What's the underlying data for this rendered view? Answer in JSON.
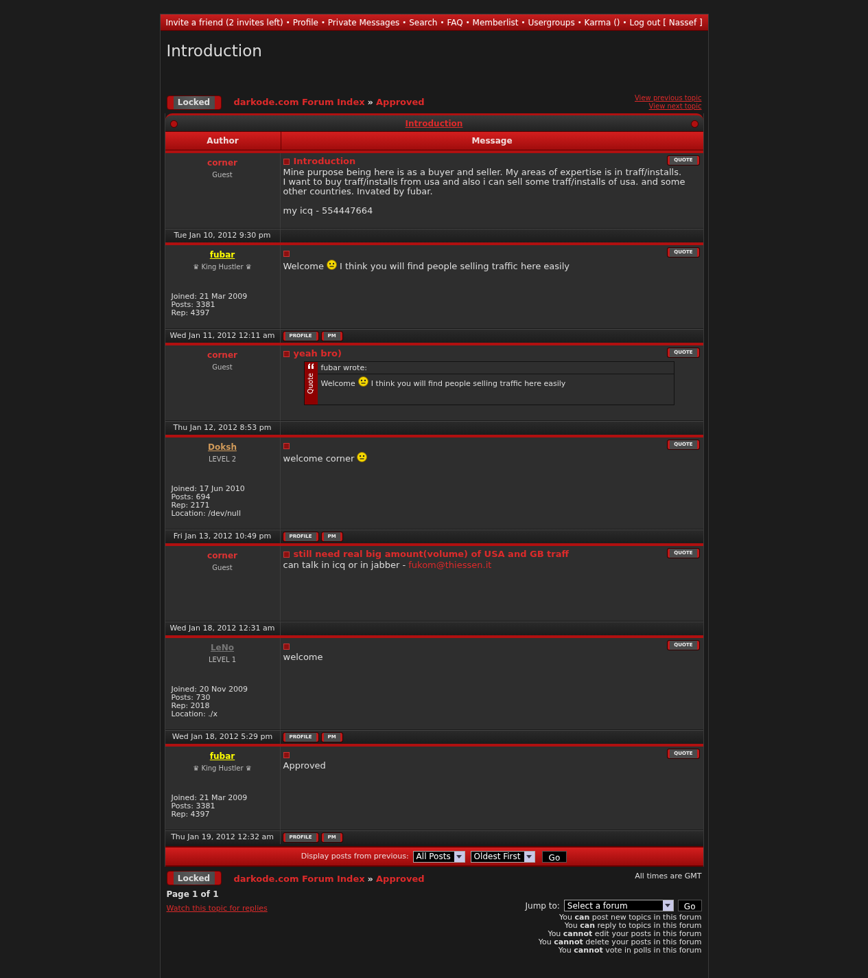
{
  "nav": {
    "separator": "•",
    "items": [
      "Invite a friend (2 invites left)",
      "Profile",
      "Private Messages",
      "Search",
      "FAQ",
      "Memberlist",
      "Usergroups",
      "Karma ()",
      "Log out [ Nassef ]"
    ]
  },
  "page_title": "Introduction",
  "top_bar": {
    "status_button": "Locked",
    "breadcrumb": [
      "darkode.com Forum Index",
      "Approved"
    ],
    "breadcrumb_separator": "»",
    "topic_links": [
      "View previous topic",
      "View next topic"
    ]
  },
  "topic_header": "Introduction",
  "columns": [
    "Author",
    "Message"
  ],
  "posts": [
    {
      "author": "corner",
      "color": "#dd3333",
      "underlined": false,
      "rank": "Guest",
      "date": "Tue Jan 10, 2012 9:30 pm",
      "subject": "Introduction",
      "quote_button": "QUOTE",
      "body": [
        [
          [
            {
              "kind": "text",
              "text": "Mine purpose being here is as a buyer and seller. My areas of expertise is in traff/installs."
            }
          ],
          [
            {
              "kind": "text",
              "text": "I want to buy traff/installs from usa and also i can sell some traff/installs of usa. and some other countries. Invated by fubar."
            }
          ]
        ],
        [
          [
            {
              "kind": "text",
              "text": "my icq - 554447664"
            }
          ]
        ]
      ]
    },
    {
      "author": "fubar",
      "color": "#ffff00",
      "underlined": true,
      "rank": "♛ King Hustler ♛",
      "stats": [
        "Joined: 21 Mar 2009",
        "Posts: 3381",
        "Rep: 4397"
      ],
      "date": "Wed Jan 11, 2012 12:11 am",
      "quote_button": "QUOTE",
      "body": [
        [
          [
            {
              "kind": "text",
              "text": "Welcome"
            },
            {
              "kind": "smiley"
            },
            {
              "kind": "text",
              "text": "I think you will find people selling traffic here easily"
            }
          ]
        ]
      ],
      "buttons": [
        "PROFILE",
        "PM"
      ]
    },
    {
      "author": "corner",
      "color": "#dd3333",
      "underlined": false,
      "rank": "Guest",
      "date": "Thu Jan 12, 2012 8:53 pm",
      "subject": "yeah bro)",
      "quote_button": "QUOTE",
      "body": [
        [
          [
            {
              "kind": "quote",
              "label": "Quote",
              "author": "fubar wrote:",
              "body": [
                {
                  "kind": "text",
                  "text": "Welcome"
                },
                {
                  "kind": "smiley"
                },
                {
                  "kind": "text",
                  "text": "I think you will find people selling traffic here easily"
                }
              ]
            }
          ]
        ]
      ]
    },
    {
      "author": "Doksh",
      "color": "#d09a5a",
      "underlined": true,
      "rank": "LEVEL 2",
      "stats": [
        "Joined: 17 Jun 2010",
        "Posts: 694",
        "Rep: 2171",
        "Location: /dev/null"
      ],
      "date": "Fri Jan 13, 2012 10:49 pm",
      "quote_button": "QUOTE",
      "body": [
        [
          [
            {
              "kind": "text",
              "text": "welcome corner"
            },
            {
              "kind": "smiley"
            }
          ]
        ]
      ],
      "buttons": [
        "PROFILE",
        "PM"
      ]
    },
    {
      "author": "corner",
      "color": "#dd3333",
      "underlined": false,
      "rank": "Guest",
      "date": "Wed Jan 18, 2012 12:31 am",
      "subject": "still need real big amount(volume) of USA and GB traff",
      "quote_button": "QUOTE",
      "body": [
        [
          [
            {
              "kind": "text",
              "text": "can talk in icq or in jabber -"
            },
            {
              "kind": "link",
              "text": "fukom@thiessen.it"
            }
          ]
        ]
      ]
    },
    {
      "author": "LeNo",
      "color": "#777777",
      "underlined": true,
      "rank": "LEVEL 1",
      "stats": [
        "Joined: 20 Nov 2009",
        "Posts: 730",
        "Rep: 2018",
        "Location: ./x"
      ],
      "date": "Wed Jan 18, 2012 5:29 pm",
      "quote_button": "QUOTE",
      "body": [
        [
          [
            {
              "kind": "text",
              "text": "welcome"
            }
          ]
        ]
      ],
      "buttons": [
        "PROFILE",
        "PM"
      ]
    },
    {
      "author": "fubar",
      "color": "#ffff00",
      "underlined": true,
      "rank": "♛ King Hustler ♛",
      "stats": [
        "Joined: 21 Mar 2009",
        "Posts: 3381",
        "Rep: 4397"
      ],
      "date": "Thu Jan 19, 2012 12:32 am",
      "quote_button": "QUOTE",
      "body": [
        [
          [
            {
              "kind": "text",
              "text": "Approved"
            }
          ]
        ]
      ],
      "buttons": [
        "PROFILE",
        "PM"
      ]
    }
  ],
  "display_bar": {
    "label": "Display posts from previous:",
    "selects": [
      "All Posts",
      "Oldest First"
    ],
    "button": "Go"
  },
  "bottom": {
    "status_button": "Locked",
    "breadcrumb": [
      "darkode.com Forum Index",
      "Approved"
    ],
    "breadcrumb_separator": "»",
    "timezone": "All times are GMT",
    "pagination": "Page 1 of 1",
    "watch_link": "Watch this topic for replies",
    "jump_label": "Jump to:",
    "jump_select": "Select a forum",
    "jump_button": "Go",
    "permissions": [
      "You **can** post new topics in this forum",
      "You **can** reply to topics in this forum",
      "You **cannot** edit your posts in this forum",
      "You **cannot** delete your posts in this forum",
      "You **cannot** vote in polls in this forum"
    ]
  }
}
